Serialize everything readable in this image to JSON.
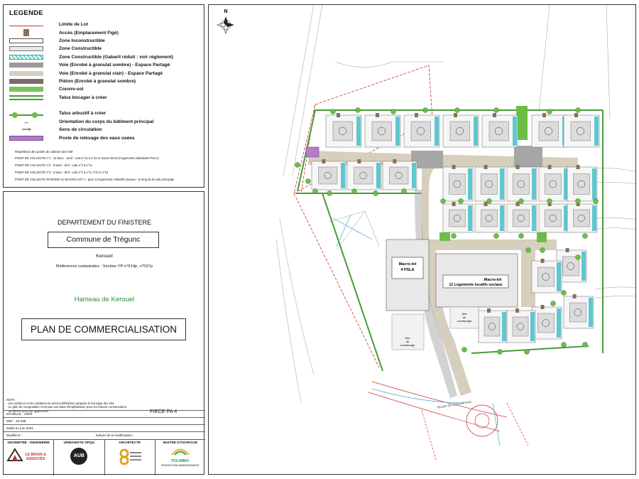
{
  "legend": {
    "title": "LEGENDE",
    "items": [
      {
        "label": "Limite de Lot",
        "swatch": "line"
      },
      {
        "label": "Accès (Emplacement Figé)",
        "swatch": "access"
      },
      {
        "label": "Zone Inconstructible",
        "swatch": "inconstr"
      },
      {
        "label": "Zone Constructible",
        "swatch": "constr"
      },
      {
        "label": "Zone Constructible (Gabarit réduit : voir règlement)",
        "swatch": "gabarit"
      },
      {
        "label": "Voie (Enrobé à granulat sombre) - Espace Partagé",
        "swatch": "dark"
      },
      {
        "label": "Voie (Enrobé à granulat clair) - Espace Partagé",
        "swatch": "clear"
      },
      {
        "label": "Piéton (Enrobé à granulat sombre)",
        "swatch": "pieton"
      },
      {
        "label": "Couvre-sol",
        "swatch": "couvre"
      },
      {
        "label": "Talus bocager à créer",
        "swatch": "talus"
      },
      {
        "label": "",
        "swatch": "blank"
      },
      {
        "label": "Talus arbustif à créer",
        "swatch": "talusarb"
      },
      {
        "label": "Orientation du corps du bâtiment principal",
        "swatch": "orient"
      },
      {
        "label": "Sens de circulation",
        "swatch": "sens"
      },
      {
        "label": "Poste de relevage des eaux usées",
        "swatch": "poste"
      }
    ],
    "collect_head": "Répartition des points de collecte des OM",
    "collect_items": [
      "POINT DE COLLECTE n°1 : 14 bacs : 11mf - Lots n°12 à n°21 et macro-lot B (4 logements individuels PSLA)",
      "POINT DE COLLECTE n°2 : 8 bacs : 5mf - Lots n°4 à n°11",
      "POINT DE COLLECTE n°3 : 6 bacs : 5mf - Lots n°1 à n°3, n°22 à n°23",
      "POINT DE COLLECTE INTÉGRÉ AU MACRO-LOT A : pour 12 logements collectifs sociaux - le long de la voie principale"
    ]
  },
  "cartouche": {
    "department": "DEPARTEMENT DU FINISTERE",
    "commune": "Commune de Trégunc",
    "lieu": "Kerouel",
    "refs": "Références cadastrales : Section YP n°614p, n°537p",
    "hameau": "Hameau de Kerouel",
    "plan_title": "PLAN DE COMMERCIALISATION",
    "nota_lines": [
      "NOTA :",
      "- Les surfaces et les cotations ne seront définitives qu'après le bornage des lots.",
      "- Le plan de composition n'est pas une base d'implantation pour les futures constructions.",
      "- La flèche Nord est approchée."
    ],
    "piece": "PIECE PA 4",
    "echelle": "ECHELLE : 1/500",
    "ref": "REF : 18-168",
    "etabli": "Etabli en juin 2021",
    "modifie": "Modifié le :",
    "nature_modif": "Nature de la modification :",
    "logos": [
      {
        "role": "GEOMETRE - INGENIERIE",
        "name": "LE BIHAN & ASSOCIÉS",
        "sub": ""
      },
      {
        "role": "URBANISTE OPQU",
        "name": "AUB",
        "sub": ""
      },
      {
        "role": "ARCHITECTE",
        "name": "",
        "sub": ""
      },
      {
        "role": "MAITRE D'OUVRAGE",
        "name": "POLIMMO",
        "sub": "PROMOTION AMENAGEMENT"
      }
    ]
  },
  "plan": {
    "north": "N",
    "macrolot_b": [
      "Macro-lot",
      "4 PSLA"
    ],
    "macrolot_a": [
      "Macro-lot",
      "12 Logements locatifs sociaux"
    ],
    "aire1": [
      "Aire",
      "de",
      "covoiturage"
    ],
    "aire2": [
      "Aire",
      "de",
      "covoiturage"
    ],
    "route": "Route de Concarneau",
    "colors": {
      "road_dark": "#a6a6a6",
      "road_clear": "#d6cfbe",
      "gabarit": "#5fc7cf",
      "green": "#6cbf45",
      "lot_line": "#cc3333",
      "access": "#8b6f5e"
    }
  }
}
